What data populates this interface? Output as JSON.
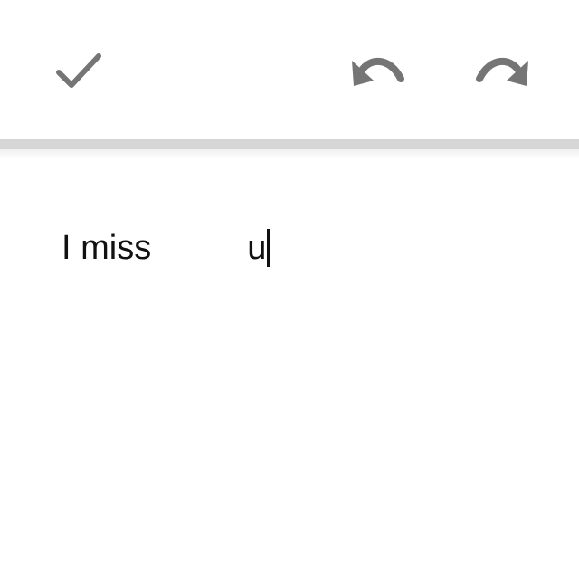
{
  "toolbar": {
    "done_icon": "checkmark-icon",
    "undo_icon": "undo-icon",
    "redo_icon": "redo-icon",
    "icon_color": "#757575"
  },
  "editor": {
    "text_before": "I miss",
    "text_after": "u",
    "text_color": "#111111"
  }
}
